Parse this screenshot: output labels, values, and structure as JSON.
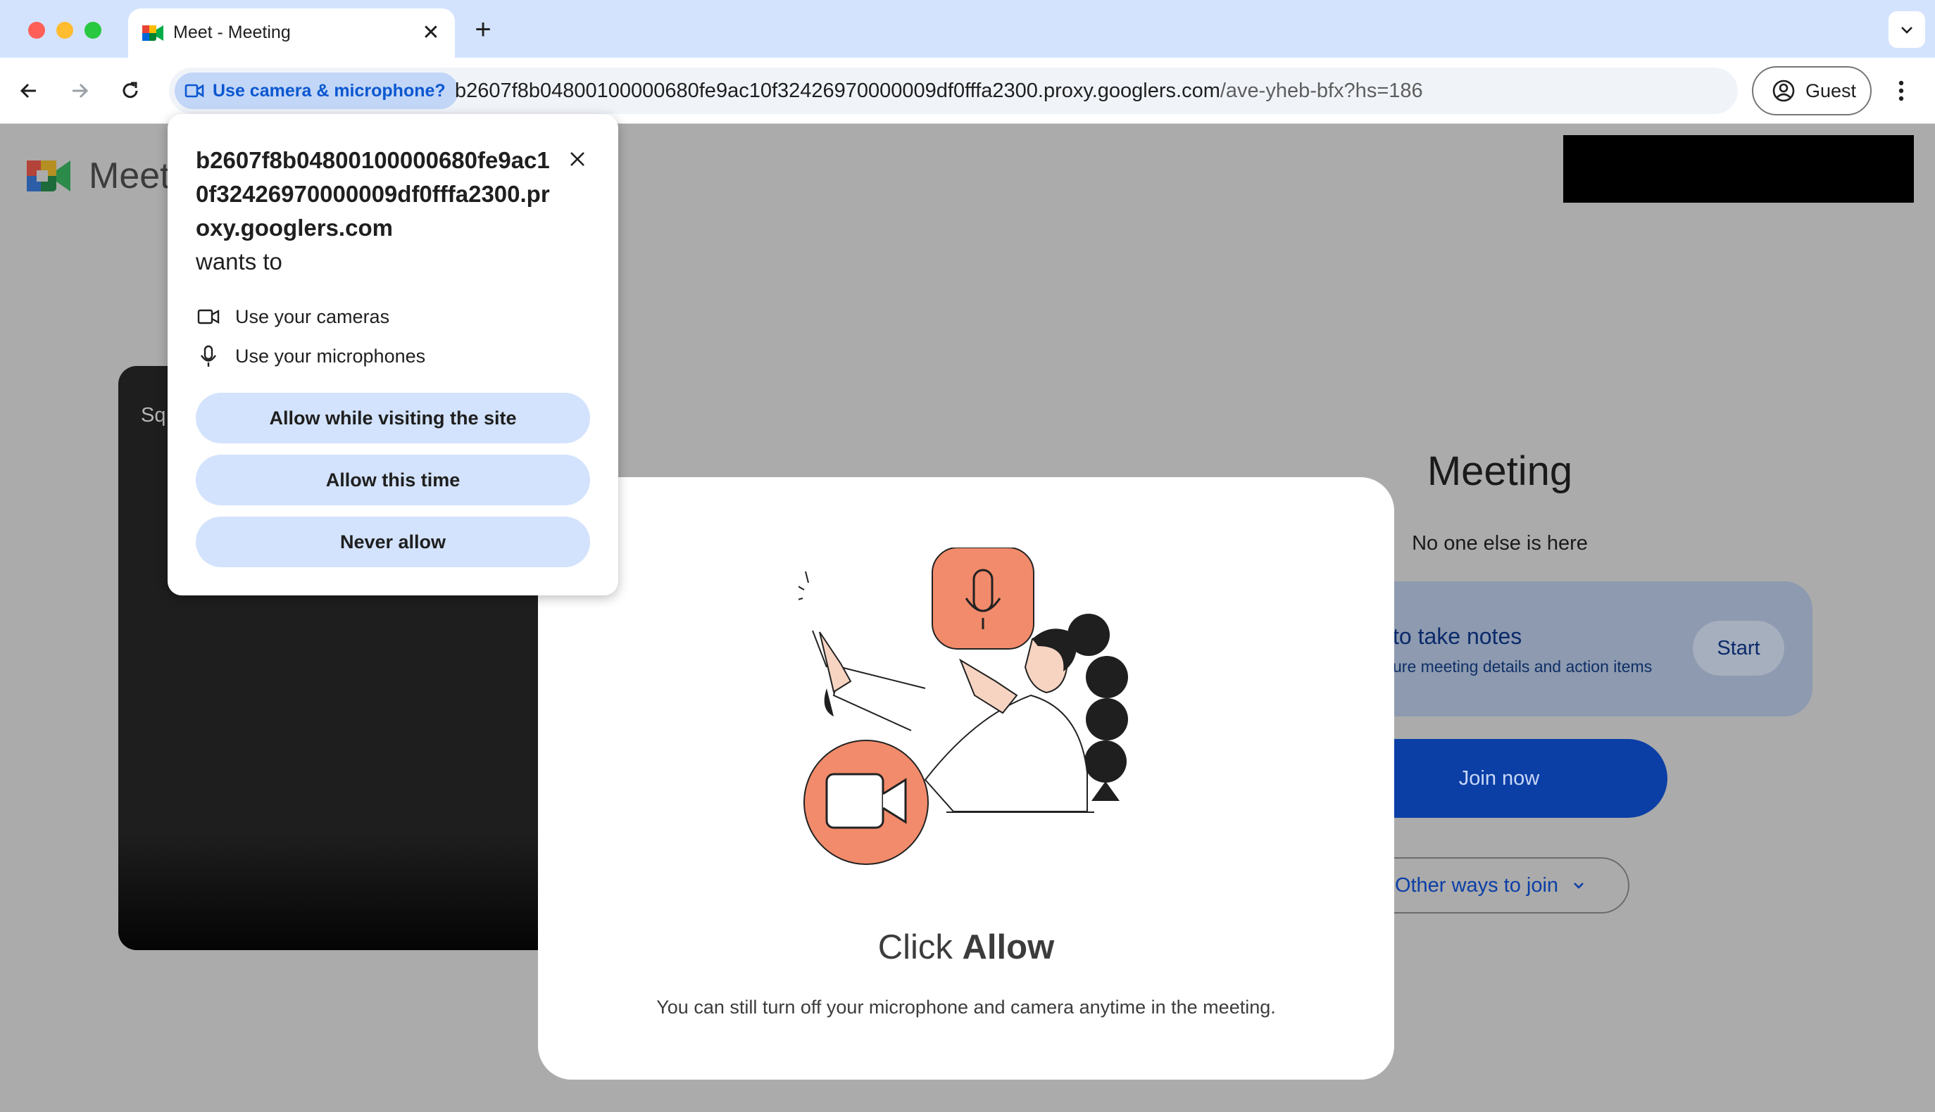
{
  "browser": {
    "tab_title": "Meet - Meeting",
    "tab_close_glyph": "✕",
    "new_tab_glyph": "+",
    "permission_chip": "Use camera & microphone?",
    "url_host": "b2607f8b04800100000680fe9ac10f32426970000009df0fffa2300.proxy.googlers.com",
    "url_path": "/ave-yheb-bfx?hs=186",
    "profile_label": "Guest",
    "icons": [
      "back-icon",
      "forward-icon",
      "reload-icon",
      "camera-icon",
      "profile-icon",
      "more-vert-icon",
      "tab-search-icon"
    ]
  },
  "page": {
    "wordmark": "Meet",
    "video_name": "Sq",
    "meeting_title": "Meeting",
    "status_text": "No one else is here",
    "notes_title": "to take notes",
    "notes_subtitle": "ure meeting details and action items",
    "notes_start": "Start",
    "join_label": "Join now",
    "other_ways_label": "Other ways to join"
  },
  "allow_dialog": {
    "heading_prefix": "Click ",
    "heading_bold": "Allow",
    "body": "You can still turn off your microphone and camera anytime in the meeting."
  },
  "permission_prompt": {
    "origin": "b2607f8b04800100000680fe9ac10f32426970000009df0fffa2300.proxy.googlers.com",
    "wants_to": "wants to",
    "items": [
      {
        "label": "Use your cameras",
        "icon": "videocam-icon"
      },
      {
        "label": "Use your microphones",
        "icon": "mic-icon"
      }
    ],
    "buttons": {
      "allow_visiting": "Allow while visiting the site",
      "allow_once": "Allow this time",
      "never": "Never allow"
    }
  },
  "colors": {
    "accent": "#0b57d0",
    "button_bg": "#d3e3fd",
    "illustration_orange": "#f28b6b",
    "scrim": "#ababab"
  }
}
